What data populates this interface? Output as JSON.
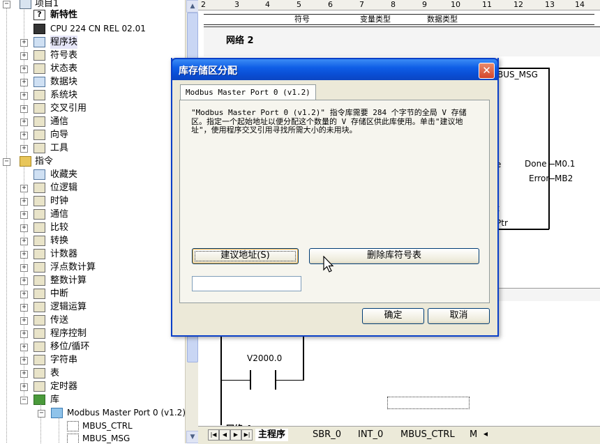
{
  "tree": {
    "top_item": "项目1",
    "items": [
      {
        "label": "新特性",
        "bold": true,
        "icon": "help-icon"
      },
      {
        "label": "CPU 224 CN REL 02.01",
        "icon": "cpu-icon"
      },
      {
        "label": "程序块",
        "icon": "program-block-icon",
        "selected": true
      },
      {
        "label": "符号表",
        "icon": "symbol-table-icon"
      },
      {
        "label": "状态表",
        "icon": "status-table-icon"
      },
      {
        "label": "数据块",
        "icon": "data-block-icon"
      },
      {
        "label": "系统块",
        "icon": "system-block-icon"
      },
      {
        "label": "交叉引用",
        "icon": "cross-reference-icon"
      },
      {
        "label": "通信",
        "icon": "communication-icon"
      },
      {
        "label": "向导",
        "icon": "wizard-icon"
      },
      {
        "label": "工具",
        "icon": "tools-icon"
      }
    ],
    "instructions_label": "指令",
    "instructions": [
      "收藏夹",
      "位逻辑",
      "时钟",
      "通信",
      "比较",
      "转换",
      "计数器",
      "浮点数计算",
      "整数计算",
      "中断",
      "逻辑运算",
      "传送",
      "程序控制",
      "移位/循环",
      "字符串",
      "表",
      "定时器"
    ],
    "library_label": "库",
    "library_folder": "Modbus Master Port 0 (v1.2)",
    "library_items": [
      "MBUS_CTRL",
      "MBUS_MSG"
    ]
  },
  "ruler": {
    "marks": [
      "2",
      "3",
      "4",
      "5",
      "6",
      "7",
      "8",
      "9",
      "10",
      "11",
      "12",
      "13",
      "14"
    ]
  },
  "symbol_header": {
    "col1": "符号",
    "col2": "变量类型",
    "col3": "数据类型"
  },
  "network2": {
    "title": "网络 2"
  },
  "ladder": {
    "block_name": "BUS_MSG",
    "done_pin": "Done",
    "done_addr": "M0.1",
    "error_pin": "Error",
    "error_addr": "MB2",
    "pin_t": "t",
    "pin_ptr": "Ptr",
    "pin_e": "e",
    "contact_label": "V2000.0",
    "network4_partial": "网络 4"
  },
  "tabs": {
    "items": [
      "主程序",
      "SBR_0",
      "INT_0",
      "MBUS_CTRL",
      "M"
    ],
    "active": "主程序"
  },
  "dialog": {
    "title": "库存储区分配",
    "close_symbol": "✕",
    "tab_label": "Modbus Master Port 0 (v1.2)",
    "message": "\"Modbus Master Port 0 (v1.2)\" 指令库需要 284 个字节的全局 V 存储区。指定一个起始地址以便分配这个数量的 V 存储区供此库使用。单击\"建议地址\"，使用程序交叉引用寻找所需大小的未用块。",
    "suggest_button": "建议地址(S)",
    "delete_button": "删除库符号表",
    "address_value": "",
    "ok_button": "确定",
    "cancel_button": "取消"
  },
  "colors": {
    "title_bar": "#0a4fd6",
    "dialog_bg": "#ece9d8",
    "close_button": "#d4452a"
  }
}
